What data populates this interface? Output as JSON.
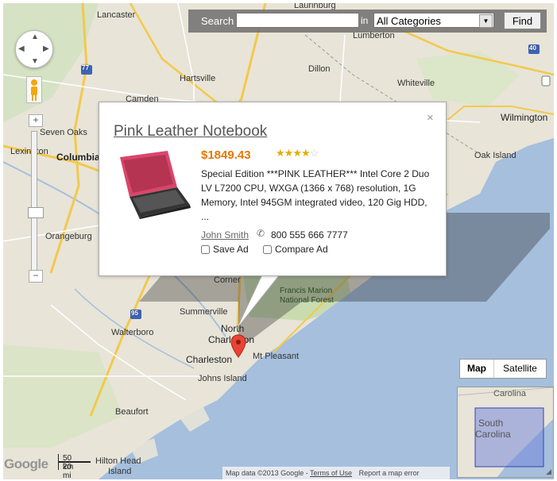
{
  "search": {
    "label": "Search",
    "query_value": "",
    "in_label": "in",
    "category_selected": "All Categories",
    "find_label": "Find"
  },
  "popup": {
    "title": "Pink Leather Notebook",
    "close_symbol": "×",
    "price": "$1849.43",
    "rating": 4,
    "rating_max": 5,
    "description": "Special Edition ***PINK LEATHER*** Intel Core 2 Duo LV L7200 CPU, WXGA (1366 x 768) resolution, 1G Memory, Intel 945GM integrated video, 120 Gig HDD, ...",
    "seller": "John Smith",
    "phone": "800 555 666 7777",
    "save_label": "Save Ad",
    "compare_label": "Compare Ad"
  },
  "map_labels": {
    "lancaster": "Lancaster",
    "laurinburg": "Laurinburg",
    "lumberton": "Lumberton",
    "dillon": "Dillon",
    "hartsville": "Hartsville",
    "whiteville": "Whiteville",
    "camden": "Camden",
    "wilmington": "Wilmington",
    "seven_oaks": "Seven Oaks",
    "lexington": "Lexington",
    "columbia": "Columbia",
    "oak_island": "Oak Island",
    "orangeburg": "Orangeburg",
    "corner": "Corner",
    "francis_marion": "Francis Marion",
    "national_forest": "National Forest",
    "summerville": "Summerville",
    "walterboro": "Walterboro",
    "north": "North",
    "charleston_top": "Charleston",
    "charleston": "Charleston",
    "mt_pleasant": "Mt Pleasant",
    "johns_island": "Johns Island",
    "beaufort": "Beaufort",
    "hilton_head": "Hilton Head",
    "island": "Island",
    "hwy_77": "77",
    "hwy_95": "95",
    "hwy_40": "40"
  },
  "map_type": {
    "map": "Map",
    "satellite": "Satellite"
  },
  "overview": {
    "carolina": "Carolina",
    "south": "South",
    "south_carolina": "Carolina"
  },
  "scale": {
    "km": "50 km",
    "mi": "20 mi"
  },
  "logo": "Google",
  "footer": {
    "attribution": "Map data ©2013 Google - ",
    "terms": "Terms of Use",
    "report": "Report a map error"
  },
  "controls": {
    "zoom_in": "+",
    "zoom_out": "−"
  },
  "colors": {
    "water": "#a5bfdd",
    "land": "#e8e4d8",
    "forest": "#c8dcb0",
    "price": "#e8760a"
  }
}
